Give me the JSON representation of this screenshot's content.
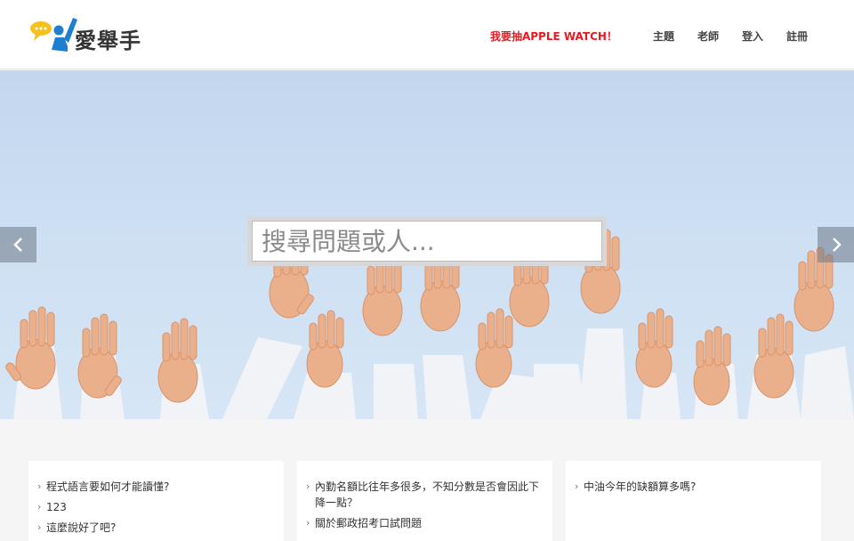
{
  "brand": {
    "name": "愛舉手"
  },
  "nav": {
    "promo": "我要抽APPLE WATCH！",
    "items": [
      "主題",
      "老師",
      "登入",
      "註冊"
    ]
  },
  "hero": {
    "search_placeholder": "搜尋問題或人..."
  },
  "cards": [
    {
      "items": [
        "程式語言要如何才能讀懂?",
        "123",
        "這麼說好了吧?"
      ]
    },
    {
      "items": [
        "內勤名額比往年多很多，不知分數是否會因此下降一點？",
        "關於郵政招考口試問題"
      ]
    },
    {
      "items": [
        "中油今年的缺額算多嗎?"
      ]
    }
  ],
  "colors": {
    "accent": "#e31b23",
    "brand_blue": "#1e7fd1",
    "brand_yellow": "#f6c11b"
  }
}
